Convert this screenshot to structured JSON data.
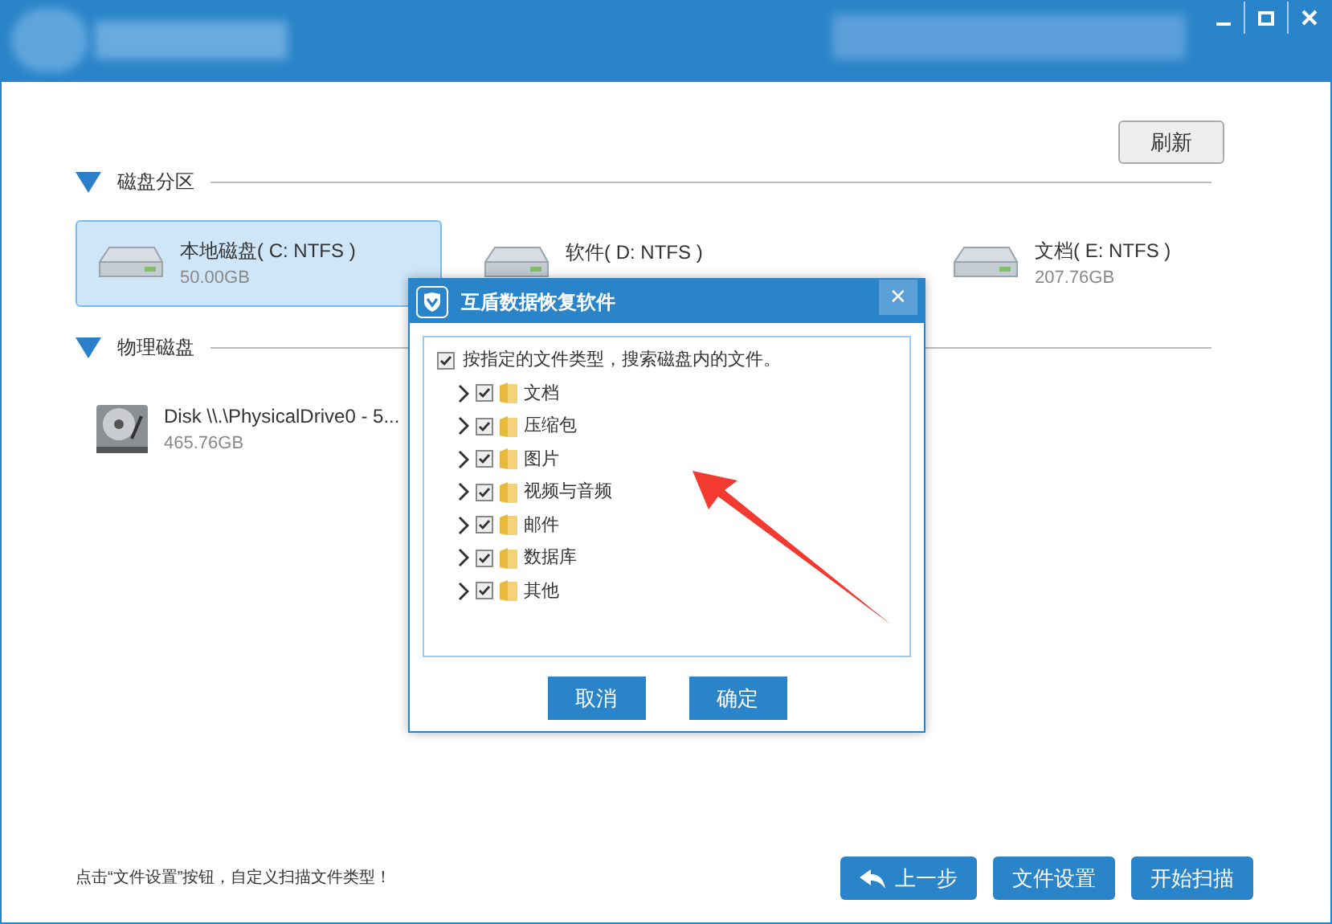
{
  "toolbar": {
    "refresh_button": "刷新"
  },
  "sections": [
    {
      "title": "磁盘分区",
      "expanded": true,
      "items": [
        {
          "kind": "partition",
          "name": "本地磁盘( C: NTFS )",
          "size": "50.00GB",
          "selected": true
        },
        {
          "kind": "partition",
          "name": "软件( D: NTFS )",
          "selected": false
        },
        {
          "kind": "partition",
          "name": "文档( E: NTFS )",
          "size": "207.76GB",
          "selected": false
        }
      ]
    },
    {
      "title": "物理磁盘",
      "expanded": true,
      "items": [
        {
          "kind": "disk",
          "name": "Disk \\\\.\\PhysicalDrive0 - 5...",
          "size": "465.76GB",
          "selected": false
        }
      ]
    }
  ],
  "dialog": {
    "title": "互盾数据恢复软件",
    "close": "✕",
    "root": {
      "label": "按指定的文件类型，搜索磁盘内的文件。",
      "checked": true
    },
    "types": [
      {
        "label": "文档",
        "checked": true,
        "expanded": false
      },
      {
        "label": "压缩包",
        "checked": true,
        "expanded": false
      },
      {
        "label": "图片",
        "checked": true,
        "expanded": false
      },
      {
        "label": "视频与音频",
        "checked": true,
        "expanded": false
      },
      {
        "label": "邮件",
        "checked": true,
        "expanded": false
      },
      {
        "label": "数据库",
        "checked": true,
        "expanded": false
      },
      {
        "label": "其他",
        "checked": true,
        "expanded": false
      }
    ],
    "buttons": [
      "取消",
      "确定"
    ]
  },
  "footer": {
    "hint": "点击“文件设置”按钮，自定义扫描文件类型！",
    "buttons": [
      {
        "label": "上一步",
        "kind": "back"
      },
      {
        "label": "文件设置",
        "kind": "plain"
      },
      {
        "label": "开始扫描",
        "kind": "plain"
      }
    ]
  }
}
